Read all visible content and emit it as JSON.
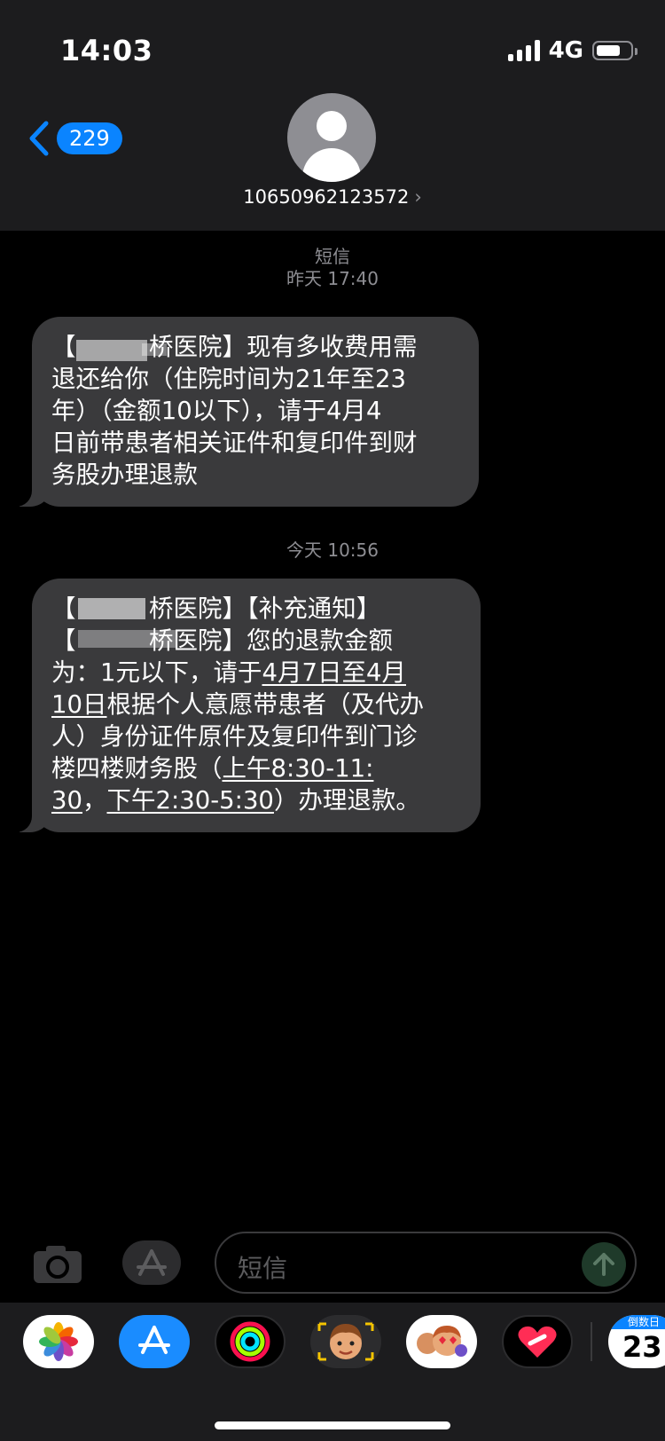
{
  "status_bar": {
    "time": "14:03",
    "network": "4G"
  },
  "header": {
    "back_count": "229",
    "contact_number": "10650962123572",
    "contact_chevron": "›"
  },
  "thread": {
    "first_timestamp_service": "短信",
    "first_timestamp_time": "昨天 17:40",
    "message1_lines": [
      "【　　　桥医院】现有多收费用需",
      "退还给你（住院时间为21年至23",
      "年）（金额10以下），请于4月4",
      "日前带患者相关证件和复印件到财",
      "务股办理退款"
    ],
    "second_timestamp_time": "今天 10:56",
    "message2": {
      "line1": "【　　　桥医院】【补充通知】",
      "line2": "【　　　桥医院】您的退款金额",
      "line3_a": "为：1元以下，请于",
      "line3_link": "4月7日至4月",
      "line4_link": "10日",
      "line4_b": "根据个人意愿带患者（及代办",
      "line5": "人）身份证件原件及复印件到门诊",
      "line6_a": "楼四楼财务股（",
      "line6_link": "上午8:30-11:",
      "line7_link1": "30",
      "line7_a": "，",
      "line7_link2": "下午2:30-5:30",
      "line7_b": "）办理退款。"
    }
  },
  "composer": {
    "placeholder": "短信"
  },
  "app_drawer": {
    "apps": [
      "photos-icon",
      "app-store-icon",
      "activity-icon",
      "memoji-icon",
      "memoji-stickers-icon",
      "heart-sticker-icon"
    ],
    "countdown_label": "倒数日",
    "countdown_number": "23"
  },
  "colors": {
    "accent": "#0a84ff",
    "bubble": "#3a3a3c",
    "header_bg": "#1c1c1e"
  }
}
